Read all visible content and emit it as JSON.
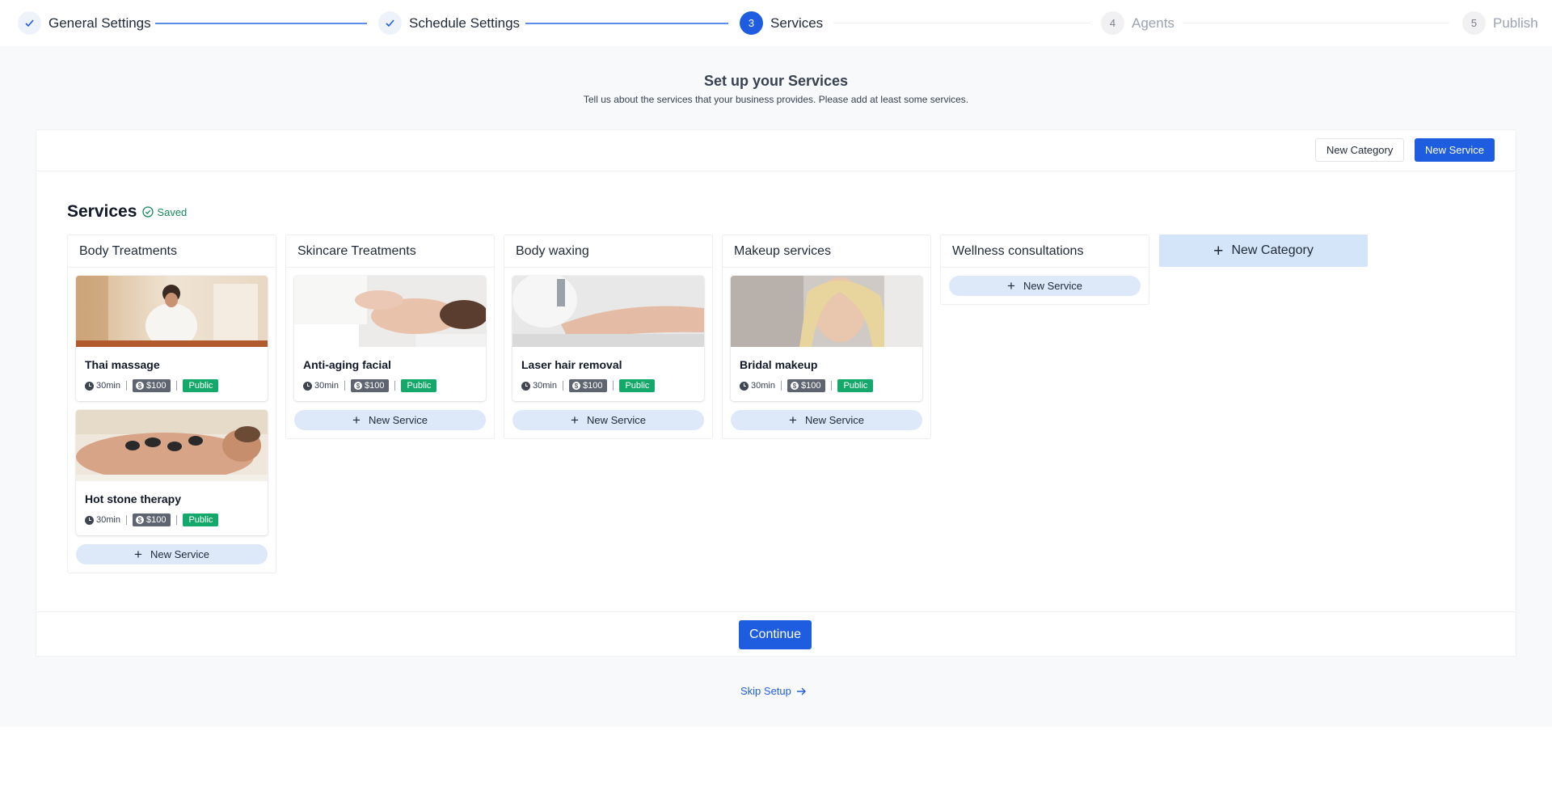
{
  "stepper": {
    "steps": [
      {
        "number": "1",
        "label": "General Settings",
        "state": "done"
      },
      {
        "number": "2",
        "label": "Schedule Settings",
        "state": "done"
      },
      {
        "number": "3",
        "label": "Services",
        "state": "active"
      },
      {
        "number": "4",
        "label": "Agents",
        "state": "pending"
      },
      {
        "number": "5",
        "label": "Publish",
        "state": "pending"
      }
    ]
  },
  "intro": {
    "title": "Set up your Services",
    "subtitle": "Tell us about the services that your business provides. Please add at least some services."
  },
  "toolbar": {
    "new_category_label": "New Category",
    "new_service_label": "New Service"
  },
  "services": {
    "title": "Services",
    "saved_label": "Saved"
  },
  "categories": [
    {
      "name": "Body Treatments",
      "add_label": "New Service",
      "services": [
        {
          "name": "Thai massage",
          "duration": "30min",
          "price": "$100",
          "visibility": "Public"
        },
        {
          "name": "Hot stone therapy",
          "duration": "30min",
          "price": "$100",
          "visibility": "Public"
        }
      ]
    },
    {
      "name": "Skincare Treatments",
      "add_label": "New Service",
      "services": [
        {
          "name": "Anti-aging facial",
          "duration": "30min",
          "price": "$100",
          "visibility": "Public"
        }
      ]
    },
    {
      "name": "Body waxing",
      "add_label": "New Service",
      "services": [
        {
          "name": "Laser hair removal",
          "duration": "30min",
          "price": "$100",
          "visibility": "Public"
        }
      ]
    },
    {
      "name": "Makeup services",
      "add_label": "New Service",
      "services": [
        {
          "name": "Bridal makeup",
          "duration": "30min",
          "price": "$100",
          "visibility": "Public"
        }
      ]
    },
    {
      "name": "Wellness consultations",
      "add_label": "New Service",
      "services": []
    }
  ],
  "new_category_tile": {
    "label": "New Category"
  },
  "footer": {
    "continue_label": "Continue",
    "skip_label": "Skip Setup"
  },
  "colors": {
    "primary": "#1f5de0",
    "public_badge": "#14a86a",
    "price_badge": "#5e6570",
    "saved": "#15895a"
  }
}
